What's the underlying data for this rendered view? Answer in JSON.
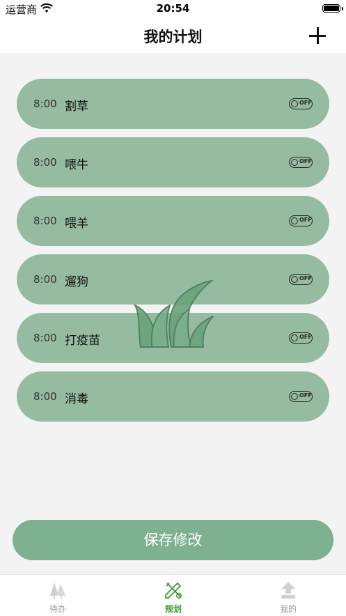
{
  "status_bar": {
    "carrier": "运营商",
    "time": "20:54"
  },
  "header": {
    "title": "我的计划",
    "add_icon": "plus-icon"
  },
  "plans": [
    {
      "time": "8:00",
      "name": "割草",
      "toggle": "OFF"
    },
    {
      "time": "8:00",
      "name": "喂牛",
      "toggle": "OFF"
    },
    {
      "time": "8:00",
      "name": "喂羊",
      "toggle": "OFF"
    },
    {
      "time": "8:00",
      "name": "遛狗",
      "toggle": "OFF"
    },
    {
      "time": "8:00",
      "name": "打疫苗",
      "toggle": "OFF"
    },
    {
      "time": "8:00",
      "name": "消毒",
      "toggle": "OFF"
    }
  ],
  "save_button": {
    "label": "保存修改"
  },
  "tabs": [
    {
      "label": "待办",
      "icon": "trees-icon",
      "active": false
    },
    {
      "label": "规划",
      "icon": "design-tools-icon",
      "active": true
    },
    {
      "label": "我的",
      "icon": "upload-user-icon",
      "active": false
    }
  ],
  "colors": {
    "accent": "#3a9a2f",
    "card": "#94c0a0",
    "save_button": "#7db18f"
  }
}
